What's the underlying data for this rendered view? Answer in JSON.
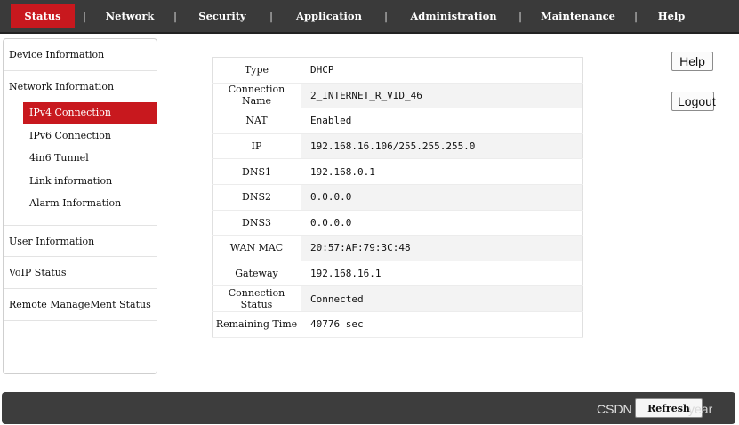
{
  "nav": {
    "items": [
      "Status",
      "Network",
      "Security",
      "Application",
      "Administration",
      "Maintenance",
      "Help"
    ],
    "active": "Status"
  },
  "sidebar": {
    "groups": [
      {
        "label": "Device Information"
      },
      {
        "label": "Network Information",
        "items": [
          "IPv4 Connection",
          "IPv6 Connection",
          "4in6 Tunnel",
          "Link information",
          "Alarm Information"
        ]
      },
      {
        "label": "User Information"
      },
      {
        "label": "VoIP Status"
      },
      {
        "label": "Remote ManageMent Status"
      }
    ],
    "active_item": "IPv4 Connection"
  },
  "connection": {
    "rows": [
      {
        "key": "Type",
        "value": "DHCP"
      },
      {
        "key": "Connection Name",
        "value": "2_INTERNET_R_VID_46"
      },
      {
        "key": "NAT",
        "value": "Enabled"
      },
      {
        "key": "IP",
        "value": "192.168.16.106/255.255.255.0"
      },
      {
        "key": "DNS1",
        "value": "192.168.0.1"
      },
      {
        "key": "DNS2",
        "value": "0.0.0.0"
      },
      {
        "key": "DNS3",
        "value": "0.0.0.0"
      },
      {
        "key": "WAN MAC",
        "value": "20:57:AF:79:3C:48"
      },
      {
        "key": "Gateway",
        "value": "192.168.16.1"
      },
      {
        "key": "Connection Status",
        "value": "Connected"
      },
      {
        "key": "Remaining Time",
        "value": "40776 sec"
      }
    ]
  },
  "buttons": {
    "help": "Help",
    "logout": "Logout",
    "refresh": "Refresh"
  },
  "watermark": "CSDN @",
  "watermark_tail": "year",
  "colors": {
    "nav_bg": "#3a3a3a",
    "accent": "#c8181e",
    "footer_bg": "#3d3d3d"
  }
}
